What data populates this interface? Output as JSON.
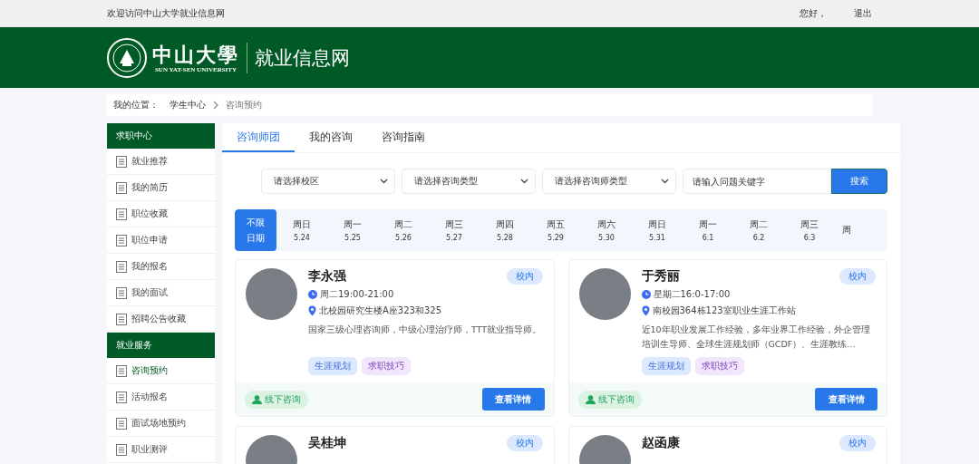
{
  "top_bar": {
    "welcome": "欢迎访问中山大学就业信息网",
    "greeting": "您好，",
    "logout": "退出"
  },
  "header": {
    "logo_name": "中山大學",
    "logo_english": "SUN YAT-SEN UNIVERSITY",
    "site_title": "就业信息网"
  },
  "breadcrumb": {
    "label": "我的位置：",
    "items": [
      "学生中心",
      "咨询预约"
    ]
  },
  "sidebar": {
    "sections": [
      {
        "title": "求职中心",
        "items": [
          {
            "label": "就业推荐",
            "selected": false
          },
          {
            "label": "我的简历",
            "selected": false
          },
          {
            "label": "职位收藏",
            "selected": false
          },
          {
            "label": "职位申请",
            "selected": false
          },
          {
            "label": "我的报名",
            "selected": false
          },
          {
            "label": "我的面试",
            "selected": false
          },
          {
            "label": "招聘公告收藏",
            "selected": false
          }
        ]
      },
      {
        "title": "就业服务",
        "items": [
          {
            "label": "咨询预约",
            "selected": true
          },
          {
            "label": "活动报名",
            "selected": false
          },
          {
            "label": "面试场地预约",
            "selected": false
          },
          {
            "label": "职业测评",
            "selected": false
          }
        ]
      }
    ]
  },
  "tabs": [
    {
      "label": "咨询师团",
      "selected": true
    },
    {
      "label": "我的咨询",
      "selected": false
    },
    {
      "label": "咨询指南",
      "selected": false
    }
  ],
  "filters": {
    "selects": [
      {
        "placeholder": "请选择校区"
      },
      {
        "placeholder": "请选择咨询类型"
      },
      {
        "placeholder": "请选择咨询师类型"
      }
    ],
    "search": {
      "placeholder": "请输入问题关键字"
    },
    "search_button": "搜索"
  },
  "dates": [
    {
      "day": "不限",
      "date": "日期",
      "selected": true
    },
    {
      "day": "周日",
      "date": "5.24",
      "selected": false
    },
    {
      "day": "周一",
      "date": "5.25",
      "selected": false
    },
    {
      "day": "周二",
      "date": "5.26",
      "selected": false
    },
    {
      "day": "周三",
      "date": "5.27",
      "selected": false
    },
    {
      "day": "周四",
      "date": "5.28",
      "selected": false
    },
    {
      "day": "周五",
      "date": "5.29",
      "selected": false
    },
    {
      "day": "周六",
      "date": "5.30",
      "selected": false
    },
    {
      "day": "周日",
      "date": "5.31",
      "selected": false
    },
    {
      "day": "周一",
      "date": "6.1",
      "selected": false
    },
    {
      "day": "周二",
      "date": "6.2",
      "selected": false
    },
    {
      "day": "周三",
      "date": "6.3",
      "selected": false
    },
    {
      "day": "周",
      "selected": false
    }
  ],
  "counselors": [
    {
      "name": "李永强",
      "badge": "校内",
      "time": "周二19:00-21:00",
      "place": "北校园研究生楼A座323和325",
      "bio": "国家三级心理咨询师，中级心理治疗师，TTT就业指导师。",
      "tags": [
        {
          "label": "生涯规划",
          "color": "#dbeafe"
        },
        {
          "label": "求职技巧",
          "color": "#f1e6fb"
        }
      ],
      "mode": "线下咨询",
      "button": "查看详情"
    },
    {
      "name": "于秀丽",
      "badge": "校内",
      "time": "星期二16:0-17:00",
      "place": "南校园364栋123室职业生涯工作站",
      "bio": "近10年职业发展工作经验，多年业界工作经验，外企管理培训生导师、全球生涯规划师（GCDF）、生涯教练…",
      "tags": [
        {
          "label": "生涯规划",
          "color": "#dbeafe"
        },
        {
          "label": "求职技巧",
          "color": "#f1e6fb"
        }
      ],
      "mode": "线下咨询",
      "button": "查看详情"
    },
    {
      "name": "吴桂坤",
      "badge": "校内"
    },
    {
      "name": "赵函康",
      "badge": "校内"
    }
  ]
}
